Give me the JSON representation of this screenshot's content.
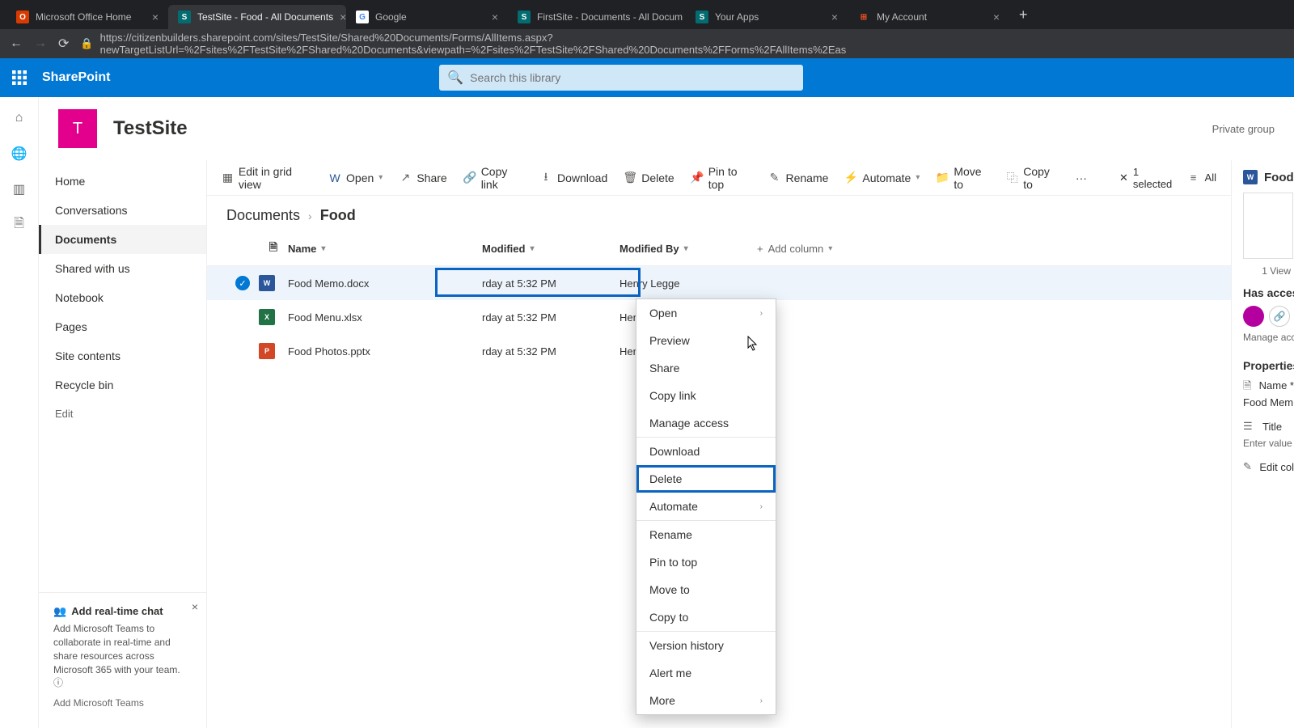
{
  "browser": {
    "tabs": [
      {
        "title": "Microsoft Office Home",
        "favicon_color": "#d83b01",
        "favicon_text": "O"
      },
      {
        "title": "TestSite - Food - All Documents",
        "favicon_color": "#036c70",
        "favicon_text": "S",
        "active": true
      },
      {
        "title": "Google",
        "favicon_color": "#fff",
        "favicon_text": "G"
      },
      {
        "title": "FirstSite - Documents - All Docum",
        "favicon_color": "#036c70",
        "favicon_text": "S"
      },
      {
        "title": "Your Apps",
        "favicon_color": "#036c70",
        "favicon_text": "S"
      },
      {
        "title": "My Account",
        "favicon_color": "#fff",
        "favicon_text": "⊞"
      }
    ],
    "url": "https://citizenbuilders.sharepoint.com/sites/TestSite/Shared%20Documents/Forms/AllItems.aspx?newTargetListUrl=%2Fsites%2FTestSite%2FShared%20Documents&viewpath=%2Fsites%2FTestSite%2FShared%20Documents%2FForms%2FAllItems%2Eas"
  },
  "suite": {
    "brand": "SharePoint",
    "search_placeholder": "Search this library"
  },
  "site": {
    "initial": "T",
    "title": "TestSite",
    "privacy": "Private group"
  },
  "left_nav": {
    "items": [
      "Home",
      "Conversations",
      "Documents",
      "Shared with us",
      "Notebook",
      "Pages",
      "Site contents",
      "Recycle bin"
    ],
    "active_index": 2,
    "edit": "Edit"
  },
  "teams_promo": {
    "title": "Add real-time chat",
    "body": "Add Microsoft Teams to collaborate in real-time and share resources across Microsoft 365 with your team.",
    "link": "Add Microsoft Teams"
  },
  "cmdbar": {
    "edit_grid": "Edit in grid view",
    "open": "Open",
    "share": "Share",
    "copylink": "Copy link",
    "download": "Download",
    "delete": "Delete",
    "pin": "Pin to top",
    "rename": "Rename",
    "automate": "Automate",
    "moveto": "Move to",
    "copyto": "Copy to",
    "selected": "1 selected",
    "all": "All"
  },
  "breadcrumb": {
    "root": "Documents",
    "current": "Food"
  },
  "columns": {
    "name": "Name",
    "modified": "Modified",
    "modified_by": "Modified By",
    "add": "Add column"
  },
  "files": [
    {
      "name": "Food Memo.docx",
      "type": "word",
      "modified": "rday at 5:32 PM",
      "by": "Henry Legge",
      "selected": true
    },
    {
      "name": "Food Menu.xlsx",
      "type": "excel",
      "modified": "rday at 5:32 PM",
      "by": "Henry Legge"
    },
    {
      "name": "Food Photos.pptx",
      "type": "ppt",
      "modified": "rday at 5:32 PM",
      "by": "Henry Legge"
    }
  ],
  "ctx": {
    "open": "Open",
    "preview": "Preview",
    "share": "Share",
    "copylink": "Copy link",
    "manage_access": "Manage access",
    "download": "Download",
    "delete": "Delete",
    "automate": "Automate",
    "rename": "Rename",
    "pin": "Pin to top",
    "moveto": "Move to",
    "copyto": "Copy to",
    "version": "Version history",
    "alert": "Alert me",
    "more": "More"
  },
  "details": {
    "file_title": "Food",
    "views": "1 View",
    "has_access": "Has access",
    "manage_access": "Manage acc",
    "properties": "Properties",
    "name_label": "Name *",
    "name_value": "Food Mem",
    "title_label": "Title",
    "title_placeholder": "Enter value",
    "edit_cols": "Edit col"
  }
}
